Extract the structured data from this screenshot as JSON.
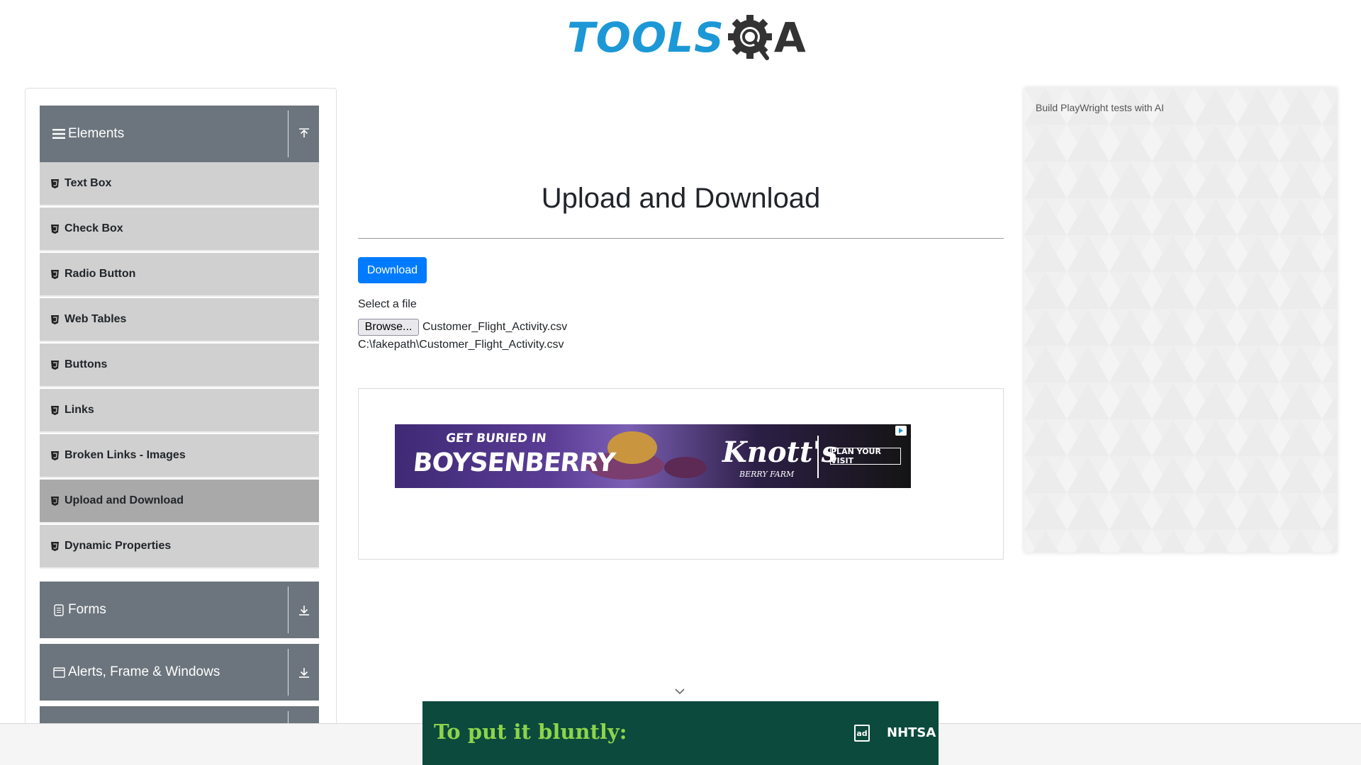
{
  "header": {
    "logo_tools": "TOOLS",
    "logo_a": "A"
  },
  "sidebar": {
    "groups": [
      {
        "title": "Elements",
        "icon": "menu-icon",
        "toggle_icon": "upload-arrow-icon",
        "expanded": true
      },
      {
        "title": "Forms",
        "icon": "form-icon",
        "toggle_icon": "download-arrow-icon",
        "expanded": false
      },
      {
        "title": "Alerts, Frame & Windows",
        "icon": "window-icon",
        "toggle_icon": "download-arrow-icon",
        "expanded": false
      }
    ],
    "items": [
      {
        "label": "Text Box"
      },
      {
        "label": "Check Box"
      },
      {
        "label": "Radio Button"
      },
      {
        "label": "Web Tables"
      },
      {
        "label": "Buttons"
      },
      {
        "label": "Links"
      },
      {
        "label": "Broken Links - Images"
      },
      {
        "label": "Upload and Download",
        "active": true
      },
      {
        "label": "Dynamic Properties"
      }
    ]
  },
  "main": {
    "title": "Upload and Download",
    "download_label": "Download",
    "select_label": "Select a file",
    "browse_label": "Browse...",
    "file_name": "Customer_Flight_Activity.csv",
    "file_path": "C:\\fakepath\\Customer_Flight_Activity.csv"
  },
  "ad_banner": {
    "line1": "GET BURIED IN",
    "line2": "BOYSENBERRY",
    "brand": "Knott's",
    "brand_sub": "BERRY FARM",
    "cta": "PLAN YOUR VISIT"
  },
  "right_panel": {
    "text": "Build PlayWright tests with AI"
  },
  "bottom_ad": {
    "text": "To put it bluntly:",
    "logo1": "ad",
    "logo2": "NHTSA"
  },
  "colors": {
    "brand_blue": "#1d98d6",
    "primary_button": "#007bff",
    "group_header": "#6c757d",
    "menu_item": "#d0d0d0",
    "menu_item_active": "#a9a9a9"
  }
}
